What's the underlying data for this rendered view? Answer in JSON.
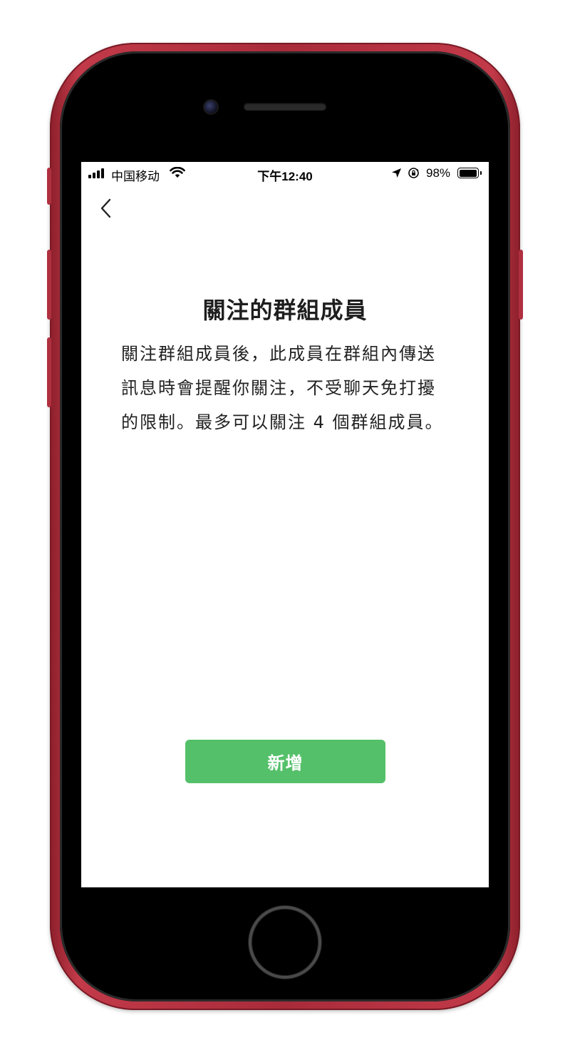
{
  "status_bar": {
    "carrier": "中国移动",
    "time": "下午12:40",
    "battery_percent": "98%",
    "battery_level": 0.98,
    "icons": [
      "signal-icon",
      "wifi-icon",
      "location-arrow-icon",
      "orientation-lock-icon",
      "battery-icon"
    ]
  },
  "nav": {
    "back_icon": "chevron-left-icon"
  },
  "content": {
    "title": "關注的群組成員",
    "description": "關注群組成員後，此成員在群組內傳送訊息時會提醒你關注，不受聊天免打擾的限制。最多可以關注 4 個群組成員。"
  },
  "actions": {
    "add_label": "新增",
    "add_color": "#55c06a"
  },
  "device": {
    "frame_color": "#b0303f"
  }
}
